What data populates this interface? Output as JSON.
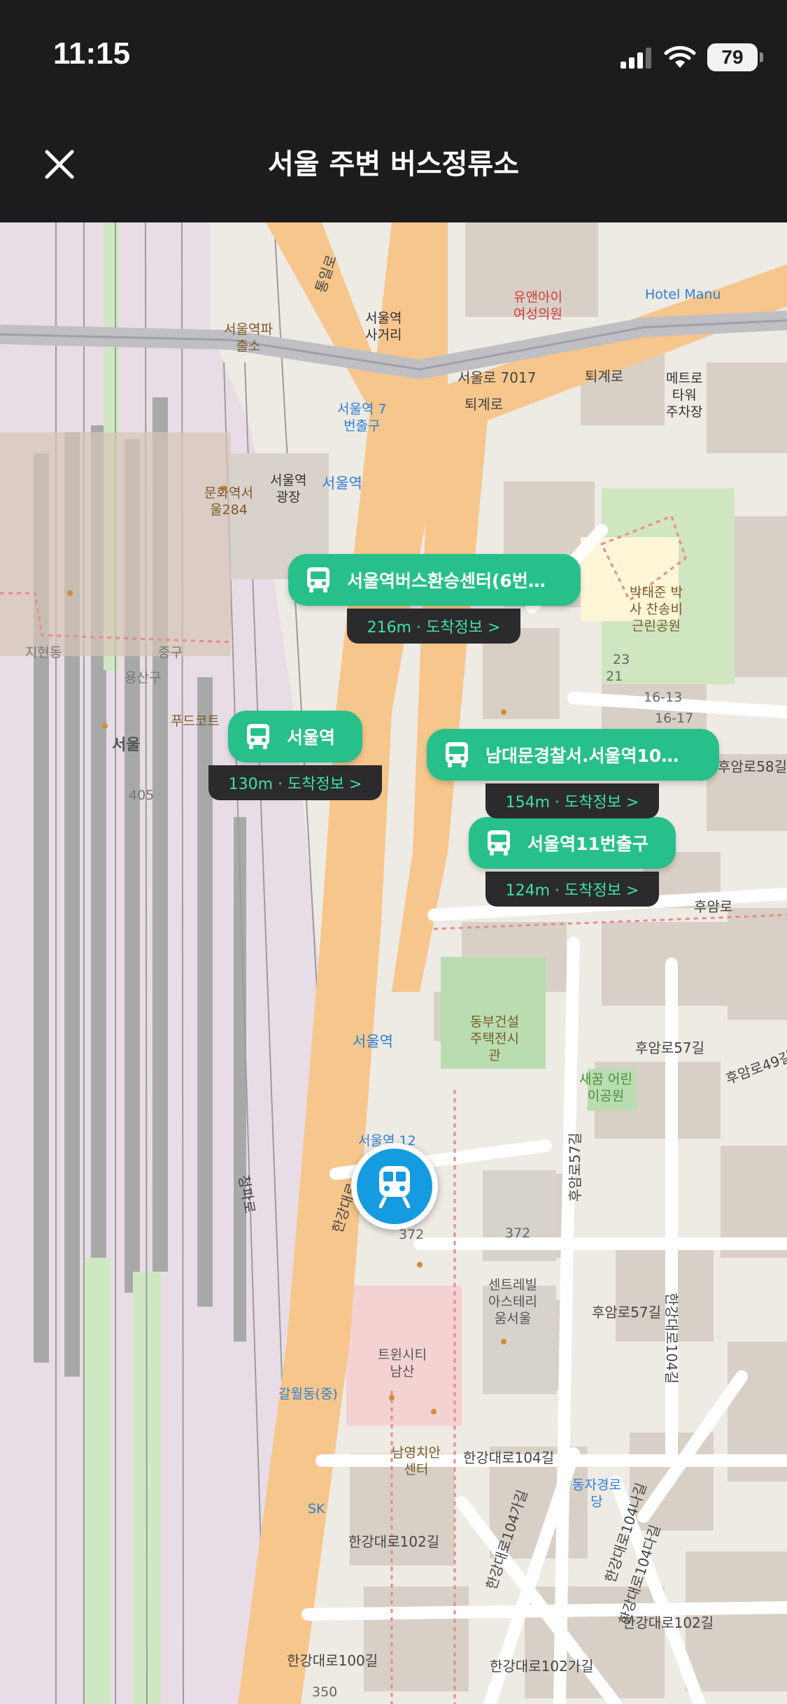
{
  "status_bar": {
    "time": "11:15",
    "battery": "79"
  },
  "header": {
    "title": "서울 주변 버스정류소",
    "close_icon": "close-icon"
  },
  "bus_stops": [
    {
      "name": "서울역버스환승센터(6번…",
      "info": "216m · 도착정보 >"
    },
    {
      "name": "서울역",
      "info": "130m · 도착정보 >"
    },
    {
      "name": "남대문경찰서.서울역10…",
      "info": "154m · 도착정보 >"
    },
    {
      "name": "서울역11번출구",
      "info": "124m · 도착정보 >"
    }
  ],
  "current_station_icon": "subway-icon",
  "map_labels": {
    "seoul_station_crossroad": "서울역\n사거리",
    "clinic": "유앤아이\n여성의원",
    "hotel": "Hotel Manu",
    "police_box": "서울역파\n출소",
    "exit7": "서울역 7\n번출구",
    "seoul_station": "서울역",
    "square": "서울역\n광장",
    "culture": "문화역서\n울284",
    "metro_tower": "메트로\n타워\n주차장",
    "park": "박태준 박\n사 찬송비\n근린공원",
    "food_court": "푸드코트",
    "seoul": "서울",
    "yongsan": "용산구",
    "jung": "중구",
    "munhyeon": "지현동",
    "num405": "405",
    "dongbu": "동부건설\n주택전시\n관",
    "small_park": "새꿈 어린\n이공원",
    "exit12": "서울역 12\n번 출구\n앞",
    "seoul_stn_bottom": "서울역",
    "num372a": "372",
    "num372b": "372",
    "centerville": "센트레빌\n아스테리\n움서울",
    "twin": "트윈시티\n남산",
    "galwol": "갈월동(중)",
    "namyoung": "남영치안\n센터",
    "sk": "SK",
    "dongja": "동자경로\n당",
    "num350": "350",
    "num23": "23",
    "num21": "21",
    "num16_13": "16-13",
    "num16_17": "16-17"
  },
  "road_labels": {
    "seoullo": "서울로 7017",
    "toegyero": "퇴계로",
    "toegyero2": "퇴계로",
    "huamro": "후암로",
    "huamro58": "후암로58길",
    "huamro57": "후암로57길",
    "huamro57b": "후암로57길",
    "huamro49": "후암로49길",
    "huamro57v": "후암로57길",
    "hangang104": "한강대로104길",
    "hangang104v": "한강대로104길",
    "hangang104ga": "한강대로104가길",
    "hangang104na": "한강대로104나길",
    "hangang104da": "한강대로104다길",
    "hangang102": "한강대로102길",
    "hangang102b": "한강대로102길",
    "hangang102ga": "한강대로102가길",
    "hangang100": "한강대로100길",
    "hangangdaero": "한강대로",
    "tongilro": "통일로",
    "cheongpa": "청파로"
  }
}
